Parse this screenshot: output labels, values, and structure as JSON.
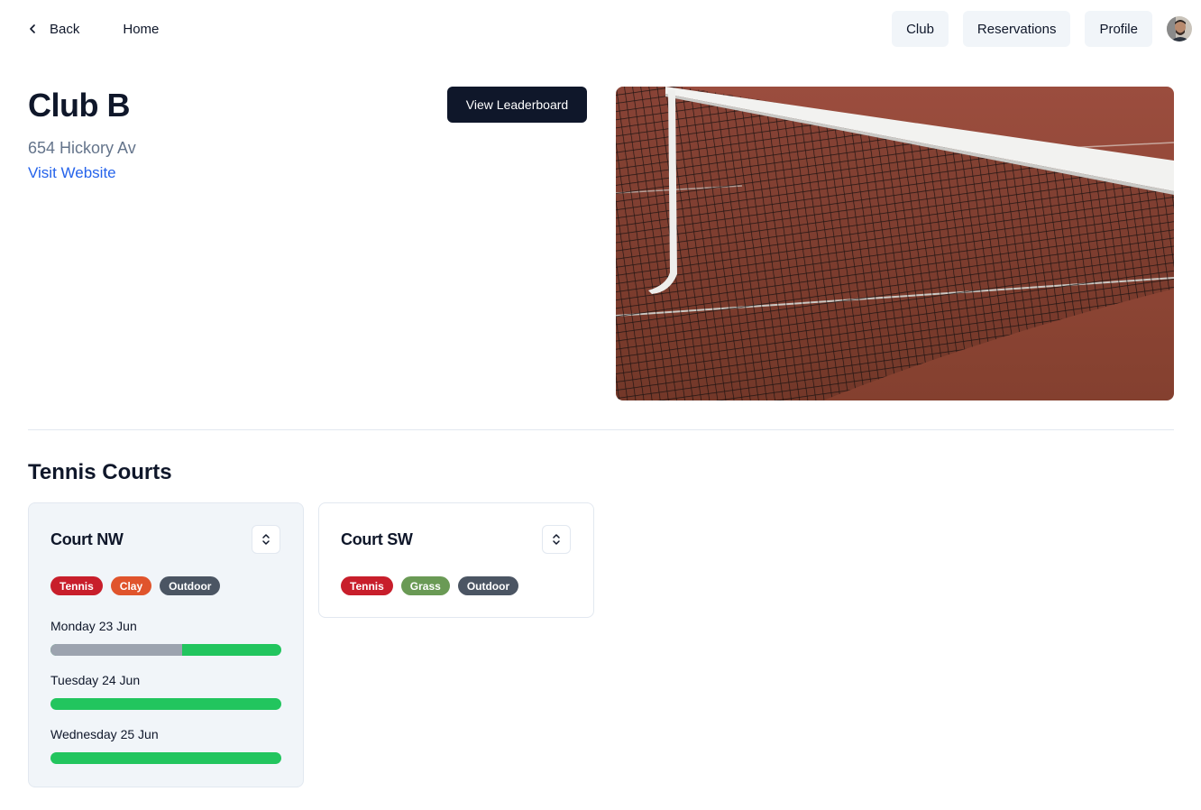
{
  "nav": {
    "back_label": "Back",
    "home_label": "Home",
    "club_label": "Club",
    "reservations_label": "Reservations",
    "profile_label": "Profile"
  },
  "club": {
    "name": "Club B",
    "address": "654 Hickory Av",
    "website_label": "Visit Website",
    "leaderboard_label": "View Leaderboard"
  },
  "section": {
    "title": "Tennis Courts"
  },
  "courts": [
    {
      "name": "Court NW",
      "tags": [
        {
          "label": "Tennis",
          "color": "#c81e2b"
        },
        {
          "label": "Clay",
          "color": "#e0542c"
        },
        {
          "label": "Outdoor",
          "color": "#4b5563"
        }
      ],
      "days": [
        {
          "label": "Monday 23 Jun",
          "booked_fraction": 0.57
        },
        {
          "label": "Tuesday 24 Jun",
          "booked_fraction": 0
        },
        {
          "label": "Wednesday 25 Jun",
          "booked_fraction": 0
        }
      ]
    },
    {
      "name": "Court SW",
      "tags": [
        {
          "label": "Tennis",
          "color": "#c81e2b"
        },
        {
          "label": "Grass",
          "color": "#6a9a55"
        },
        {
          "label": "Outdoor",
          "color": "#4b5563"
        }
      ]
    }
  ],
  "colors": {
    "available": "#22c55e",
    "booked": "#9ca3af",
    "primary": "#0f172a",
    "link": "#2563eb"
  }
}
